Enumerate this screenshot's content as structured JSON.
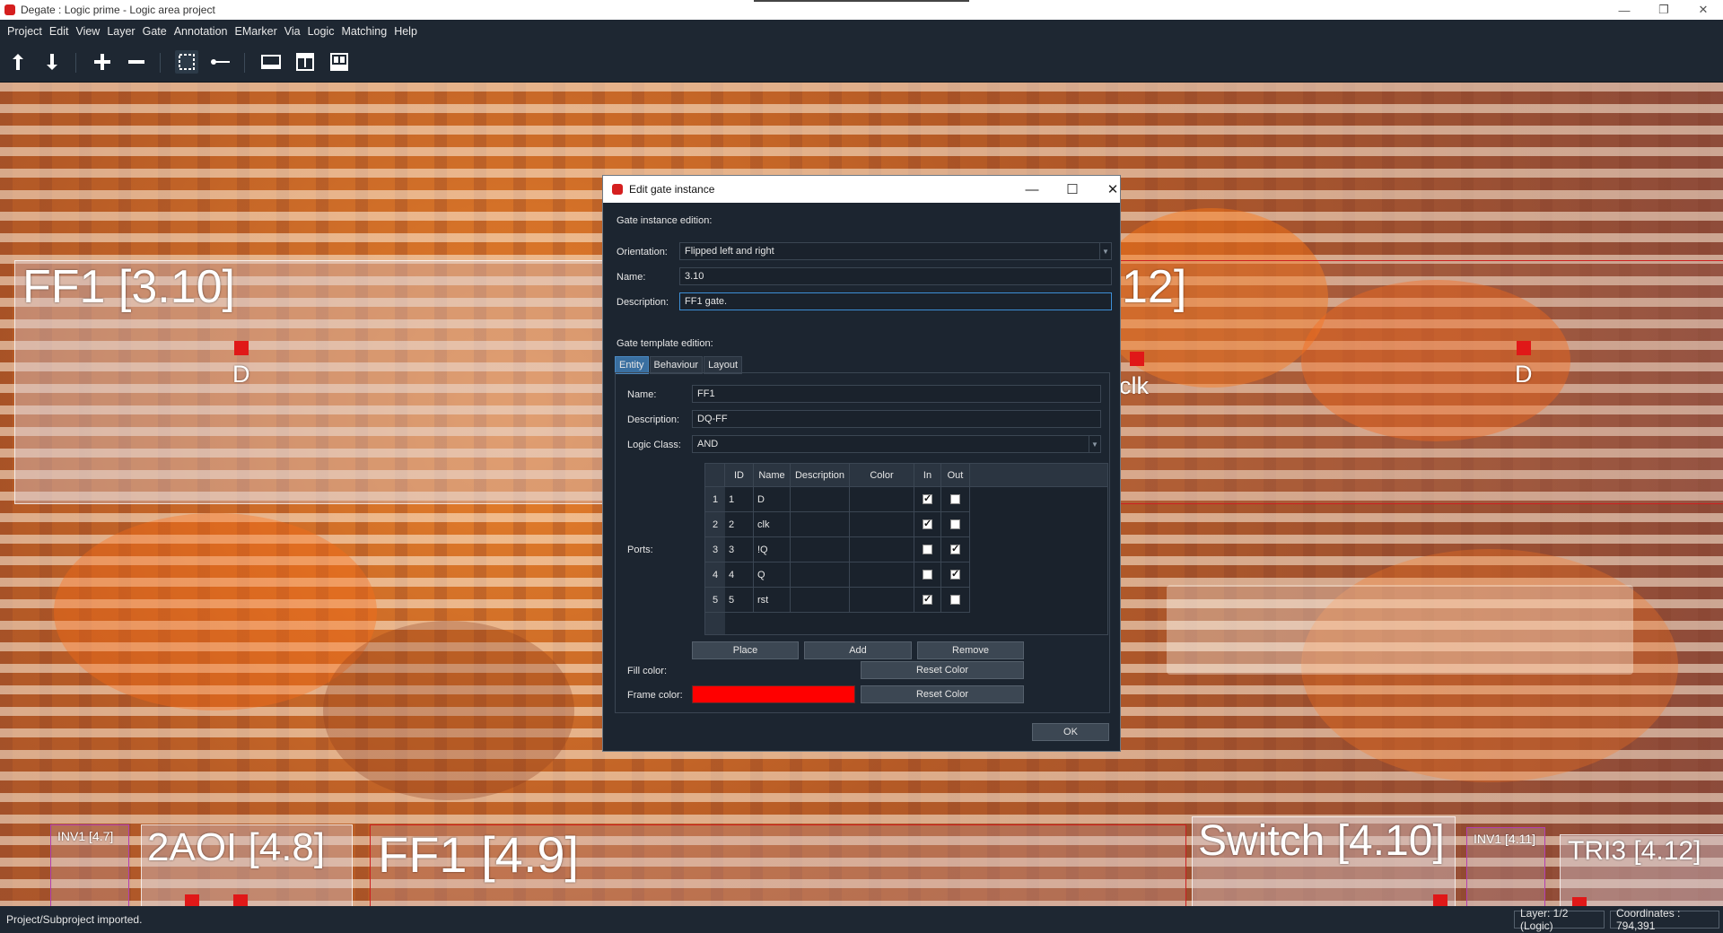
{
  "window": {
    "title": "Degate : Logic prime - Logic area project",
    "controls": [
      "minimize-icon",
      "restore-icon",
      "close-icon"
    ]
  },
  "menu": [
    "Project",
    "Edit",
    "View",
    "Layer",
    "Gate",
    "Annotation",
    "EMarker",
    "Via",
    "Logic",
    "Matching",
    "Help"
  ],
  "toolbar": {
    "icons": [
      "layer-up-icon",
      "layer-down-icon",
      "zoom-in-icon",
      "zoom-out-icon",
      "area-selection-icon",
      "wire-tool-icon",
      "gate-library-icon",
      "gate-template-icon",
      "gate-layout-icon"
    ],
    "active": "area-selection-icon"
  },
  "canvas": {
    "gates": [
      {
        "label": "FF1 [3.10]"
      },
      {
        "label": "12]"
      },
      {
        "label": "INV1 [4.7]"
      },
      {
        "label": "2AOI [4.8]"
      },
      {
        "label": "FF1 [4.9]"
      },
      {
        "label": "Switch [4.10]"
      },
      {
        "label": "INV1 [4.11]"
      },
      {
        "label": "TRI3 [4.12]"
      }
    ],
    "ports": [
      "D",
      "clk",
      "D"
    ]
  },
  "dialog": {
    "title": "Edit gate instance",
    "instance_section": "Gate instance edition:",
    "orientation_label": "Orientation:",
    "orientation_value": "Flipped left and right",
    "name_label": "Name:",
    "name_value": "3.10",
    "description_label": "Description:",
    "description_value": "FF1 gate.",
    "template_section": "Gate template edition:",
    "tabs": [
      "Entity",
      "Behaviour",
      "Layout"
    ],
    "active_tab": "Entity",
    "entity": {
      "name_label": "Name:",
      "name_value": "FF1",
      "description_label": "Description:",
      "description_value": "DQ-FF",
      "logic_class_label": "Logic Class:",
      "logic_class_value": "AND",
      "ports_label": "Ports:",
      "columns": [
        "ID",
        "Name",
        "Description",
        "Color",
        "In",
        "Out"
      ],
      "rows": [
        {
          "row": "1",
          "id": "1",
          "name": "D",
          "description": "",
          "color": "",
          "in": true,
          "out": false
        },
        {
          "row": "2",
          "id": "2",
          "name": "clk",
          "description": "",
          "color": "",
          "in": true,
          "out": false
        },
        {
          "row": "3",
          "id": "3",
          "name": "!Q",
          "description": "",
          "color": "",
          "in": false,
          "out": true
        },
        {
          "row": "4",
          "id": "4",
          "name": "Q",
          "description": "",
          "color": "",
          "in": false,
          "out": true
        },
        {
          "row": "5",
          "id": "5",
          "name": "rst",
          "description": "",
          "color": "",
          "in": true,
          "out": false
        }
      ],
      "place_button": "Place",
      "add_button": "Add",
      "remove_button": "Remove",
      "fill_color_label": "Fill color:",
      "frame_color_label": "Frame color:",
      "frame_color": "#ff0000",
      "reset_fill_button": "Reset Color",
      "reset_frame_button": "Reset Color"
    },
    "ok_button": "OK"
  },
  "status": {
    "message": "Project/Subproject imported.",
    "layer": "Layer: 1/2 (Logic)",
    "coordinates": "Coordinates : 794,391"
  }
}
